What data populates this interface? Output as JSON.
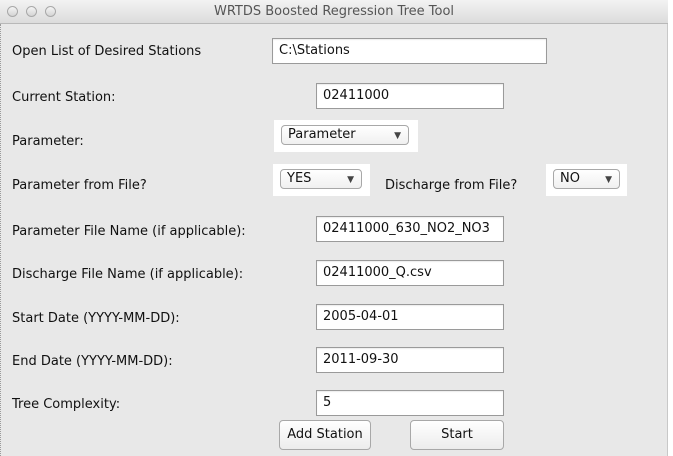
{
  "window": {
    "title": "WRTDS Boosted Regression Tree Tool"
  },
  "form": {
    "stations_list": {
      "label": "Open List of Desired Stations",
      "value": "C:\\Stations"
    },
    "current_station": {
      "label": "Current Station:",
      "value": "02411000"
    },
    "parameter": {
      "label": "Parameter:",
      "selected": "Parameter"
    },
    "parameter_from_file": {
      "label": "Parameter from File?",
      "selected": "YES"
    },
    "discharge_from_file": {
      "label": "Discharge from File?",
      "selected": "NO"
    },
    "parameter_file_name": {
      "label": "Parameter File Name (if applicable):",
      "value": "02411000_630_NO2_NO3"
    },
    "discharge_file_name": {
      "label": "Discharge File Name (if applicable):",
      "value": "02411000_Q.csv"
    },
    "start_date": {
      "label": "Start Date (YYYY-MM-DD):",
      "value": "2005-04-01"
    },
    "end_date": {
      "label": "End Date (YYYY-MM-DD):",
      "value": "2011-09-30"
    },
    "tree_complexity": {
      "label": "Tree Complexity:",
      "value": "5"
    }
  },
  "buttons": {
    "add_station": "Add Station",
    "start": "Start"
  },
  "icons": {
    "caret": "▼"
  }
}
